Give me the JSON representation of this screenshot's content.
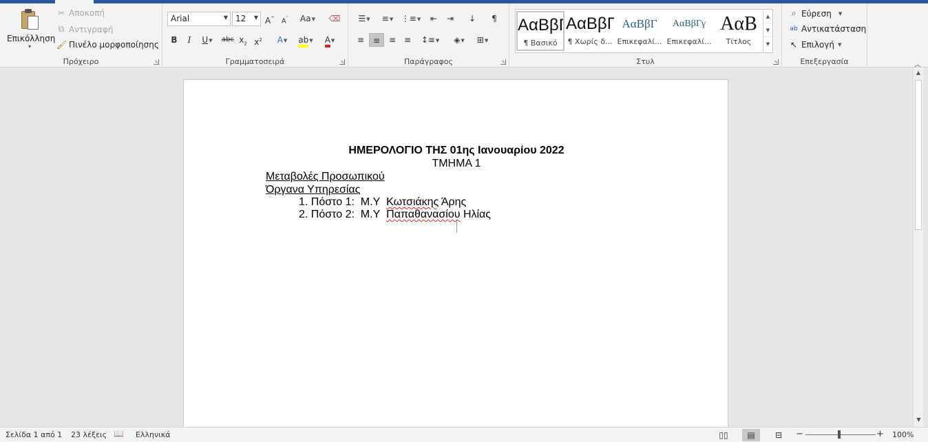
{
  "ribbon": {
    "clipboard": {
      "label": "Πρόχειρο",
      "paste": "Επικόλληση",
      "cut": "Αποκοπή",
      "copy": "Αντιγραφή",
      "format_painter": "Πινέλο μορφοποίησης"
    },
    "font": {
      "label": "Γραμματοσειρά",
      "family": "Arial",
      "size": "12"
    },
    "paragraph": {
      "label": "Παράγραφος"
    },
    "styles": {
      "label": "Στυλ",
      "items": [
        {
          "sample": "ΑαΒβΓ",
          "name": "¶ Βασικό"
        },
        {
          "sample": "ΑαΒβΓ",
          "name": "¶ Χωρίς δ..."
        },
        {
          "sample": "ΑαΒβΓ",
          "name": "Επικεφαλί..."
        },
        {
          "sample": "ΑαΒβΓγ",
          "name": "Επικεφαλί..."
        },
        {
          "sample": "ΑαΒ",
          "name": "Τίτλος"
        }
      ]
    },
    "editing": {
      "label": "Επεξεργασία",
      "find": "Εύρεση",
      "replace": "Αντικατάσταση",
      "select": "Επιλογή"
    }
  },
  "document": {
    "title": "ΗΜΕΡΟΛΟΓΙΟ ΤΗΣ 01ης Ιανουαρίου 2022",
    "subtitle": "ΤΜΗΜΑ 1",
    "heading1": "Μεταβολές Προσωπικού",
    "heading2": "Όργανα Υπηρεσίας",
    "list": [
      {
        "num": "1.",
        "post": "Πόστο 1:",
        "rank": "Μ.Υ",
        "surname": "Κωτσιάκης",
        "name": "Άρης"
      },
      {
        "num": "2.",
        "post": "Πόστο 2:",
        "rank": "Μ.Υ",
        "surname": "Παπαθανασίου",
        "name": "Ηλίας"
      }
    ]
  },
  "status": {
    "page": "Σελίδα 1 από 1",
    "words": "23 λέξεις",
    "language": "Ελληνικά",
    "zoom": "100%"
  },
  "colors": {
    "accent": "#2b579a",
    "spell_error": "#e0271d"
  }
}
